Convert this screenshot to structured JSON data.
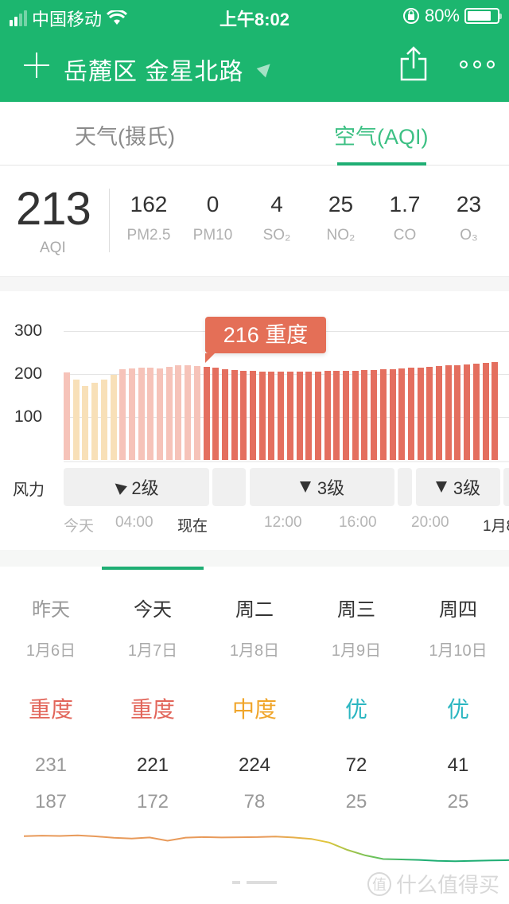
{
  "status_bar": {
    "carrier": "中国移动",
    "time": "上午8:02",
    "battery_pct": "80%",
    "battery_level": 0.8,
    "signal_bars": 2
  },
  "navbar": {
    "location": "岳麓区 金星北路",
    "add_icon": "plus-icon",
    "location_icon": "location-arrow-icon",
    "share_icon": "share-icon",
    "more_icon": "more-icon"
  },
  "tabs": [
    {
      "label": "天气(摄氏)",
      "active": false
    },
    {
      "label": "空气(AQI)",
      "active": true
    }
  ],
  "current": {
    "aqi": "213",
    "aqi_label": "AQI",
    "pollutants": [
      {
        "value": "162",
        "name": "PM2.5"
      },
      {
        "value": "0",
        "name": "PM10"
      },
      {
        "value": "4",
        "name": "SO₂"
      },
      {
        "value": "25",
        "name": "NO₂"
      },
      {
        "value": "1.7",
        "name": "CO"
      },
      {
        "value": "23",
        "name": "O₃"
      }
    ]
  },
  "hourly": {
    "tooltip": "216 重度",
    "wind_label": "风力",
    "wind_segments": [
      {
        "text": "2级",
        "dir": "left"
      },
      {
        "text": "",
        "dir": ""
      },
      {
        "text": "3级",
        "dir": "down"
      },
      {
        "text": "",
        "dir": ""
      },
      {
        "text": "3级",
        "dir": "down"
      },
      {
        "text": "",
        "dir": "down"
      }
    ],
    "time_labels": [
      {
        "text": "今天",
        "dark": false
      },
      {
        "text": "04:00",
        "dark": false
      },
      {
        "text": "现在",
        "dark": true
      },
      {
        "text": "12:00",
        "dark": false
      },
      {
        "text": "16:00",
        "dark": false
      },
      {
        "text": "20:00",
        "dark": false
      },
      {
        "text": "1月8",
        "dark": true
      }
    ]
  },
  "chart_data": {
    "type": "bar",
    "title": "",
    "xlabel": "",
    "ylabel": "",
    "ylim": [
      0,
      300
    ],
    "yticks": [
      "100",
      "200",
      "300"
    ],
    "grid": true,
    "selected_index": 15,
    "selected_label": "216 重度",
    "values": [
      204,
      187,
      172,
      179,
      187,
      198,
      211,
      213,
      214,
      214,
      213,
      217,
      220,
      220,
      218,
      216,
      214,
      212,
      210,
      208,
      207,
      206,
      206,
      205,
      205,
      205,
      206,
      206,
      207,
      207,
      208,
      208,
      209,
      210,
      211,
      212,
      213,
      214,
      215,
      217,
      218,
      220,
      221,
      223,
      225,
      226,
      228
    ],
    "series_state": [
      "past",
      "past",
      "past",
      "past",
      "past",
      "past",
      "past",
      "past",
      "past",
      "past",
      "past",
      "past",
      "past",
      "past",
      "past",
      "forecast",
      "forecast",
      "forecast",
      "forecast",
      "forecast",
      "forecast",
      "forecast",
      "forecast",
      "forecast",
      "forecast",
      "forecast",
      "forecast",
      "forecast",
      "forecast",
      "forecast",
      "forecast",
      "forecast",
      "forecast",
      "forecast",
      "forecast",
      "forecast",
      "forecast",
      "forecast",
      "forecast",
      "forecast",
      "forecast",
      "forecast",
      "forecast",
      "forecast",
      "forecast",
      "forecast",
      "forecast"
    ],
    "colors": {
      "past_heavy": "#f6c3b9",
      "past_moderate": "#f8e0b8",
      "forecast_heavy": "#e46f5f"
    }
  },
  "daily": [
    {
      "name": "昨天",
      "date": "1月6日",
      "level": "重度",
      "level_color": "#e2655a",
      "hi": "231",
      "lo": "187",
      "past": true
    },
    {
      "name": "今天",
      "date": "1月7日",
      "level": "重度",
      "level_color": "#e2655a",
      "hi": "221",
      "lo": "172",
      "past": false
    },
    {
      "name": "周二",
      "date": "1月8日",
      "level": "中度",
      "level_color": "#f0a52a",
      "hi": "224",
      "lo": "78",
      "past": false
    },
    {
      "name": "周三",
      "date": "1月9日",
      "level": "优",
      "level_color": "#2bb6c1",
      "hi": "72",
      "lo": "25",
      "past": false
    },
    {
      "name": "周四",
      "date": "1月10日",
      "level": "优",
      "level_color": "#2bb6c1",
      "hi": "41",
      "lo": "25",
      "past": false
    }
  ],
  "trend_line": {
    "values": [
      205,
      208,
      206,
      209,
      204,
      196,
      192,
      198,
      180,
      197,
      200,
      198,
      199,
      200,
      203,
      198,
      190,
      170,
      130,
      100,
      80,
      78,
      75,
      70,
      68,
      70,
      72,
      74
    ],
    "colors": [
      "#e89a5a",
      "#e3c53a",
      "#6cc25a",
      "#1fae74"
    ]
  },
  "watermark": "什么值得买",
  "watermark_badge": "值",
  "brand_color": "#1cb66f"
}
